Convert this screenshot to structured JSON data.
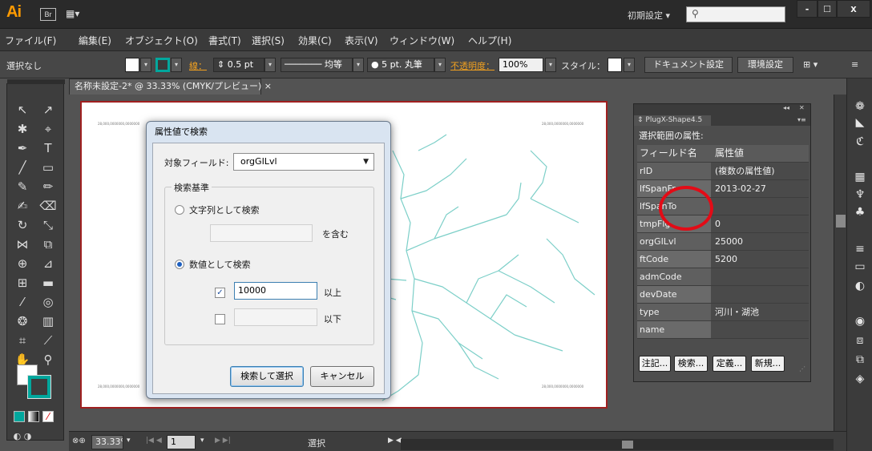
{
  "app": {
    "logo": "Ai",
    "bridge_badge": "Br",
    "workspace_label": "初期設定",
    "search_placeholder": "",
    "window_controls": {
      "minimize": "-",
      "maximize": "□",
      "close": "x"
    }
  },
  "menu": {
    "items": [
      "ファイル(F)",
      "編集(E)",
      "オブジェクト(O)",
      "書式(T)",
      "選択(S)",
      "効果(C)",
      "表示(V)",
      "ウィンドウ(W)",
      "ヘルプ(H)"
    ]
  },
  "control_bar": {
    "selection_status": "選択なし",
    "stroke_label": "線：",
    "stroke_weight": "0.5 pt",
    "stroke_profile": "均等",
    "brush": "5 pt. 丸筆",
    "opacity_label": "不透明度：",
    "opacity_value": "100%",
    "style_label": "スタイル：",
    "doc_setup_button": "ドキュメント設定",
    "preferences_button": "環境設定"
  },
  "document": {
    "tab_title": "名称未設定-2* @ 33.33% (CMYK/プレビュー)",
    "tab_close": "×",
    "corner_text_tl": "28,000,0000000,0000000",
    "corner_text_tr": "28,000,0000000,0000000",
    "corner_text_bl": "28,000,0000000,0000000",
    "corner_text_br": "28,000,0000000,0000000",
    "river_color": "#7ccfc8"
  },
  "status_bar": {
    "zoom": "33.33%",
    "artboard_number": "1",
    "status_text": "選択"
  },
  "search_dialog": {
    "title": "属性値で検索",
    "target_field_label": "対象フィールド:",
    "target_field_value": "orgGILvl",
    "criteria_group_label": "検索基準",
    "string_search_label": "文字列として検索",
    "string_contains_label": "を含む",
    "string_value": "",
    "numeric_search_label": "数値として検索",
    "min_checked": true,
    "min_value": "10000",
    "min_label": "以上",
    "max_checked": false,
    "max_value": "",
    "max_label": "以下",
    "search_button": "検索して選択",
    "cancel_button": "キャンセル"
  },
  "plugx_panel": {
    "tab_title": "PlugX-Shape4.5",
    "selection_label": "選択範囲の属性:",
    "header": {
      "field": "フィールド名",
      "value": "属性値"
    },
    "rows": [
      {
        "field": "rID",
        "value": "(複数の属性値)"
      },
      {
        "field": "lfSpanFr",
        "value": "2013-02-27"
      },
      {
        "field": "lfSpanTo",
        "value": ""
      },
      {
        "field": "tmpFlg",
        "value": "0"
      },
      {
        "field": "orgGILvl",
        "value": "25000"
      },
      {
        "field": "ftCode",
        "value": "5200"
      },
      {
        "field": "admCode",
        "value": ""
      },
      {
        "field": "devDate",
        "value": ""
      },
      {
        "field": "type",
        "value": "河川・湖池"
      },
      {
        "field": "name",
        "value": ""
      }
    ],
    "buttons": {
      "annotate": "注記...",
      "search": "検索...",
      "define": "定義...",
      "new": "新規..."
    }
  },
  "colors": {
    "accent_teal": "#00a79d",
    "highlight_red": "#e30b16",
    "artboard_border": "#a02020",
    "ai_orange": "#ff9a00"
  }
}
